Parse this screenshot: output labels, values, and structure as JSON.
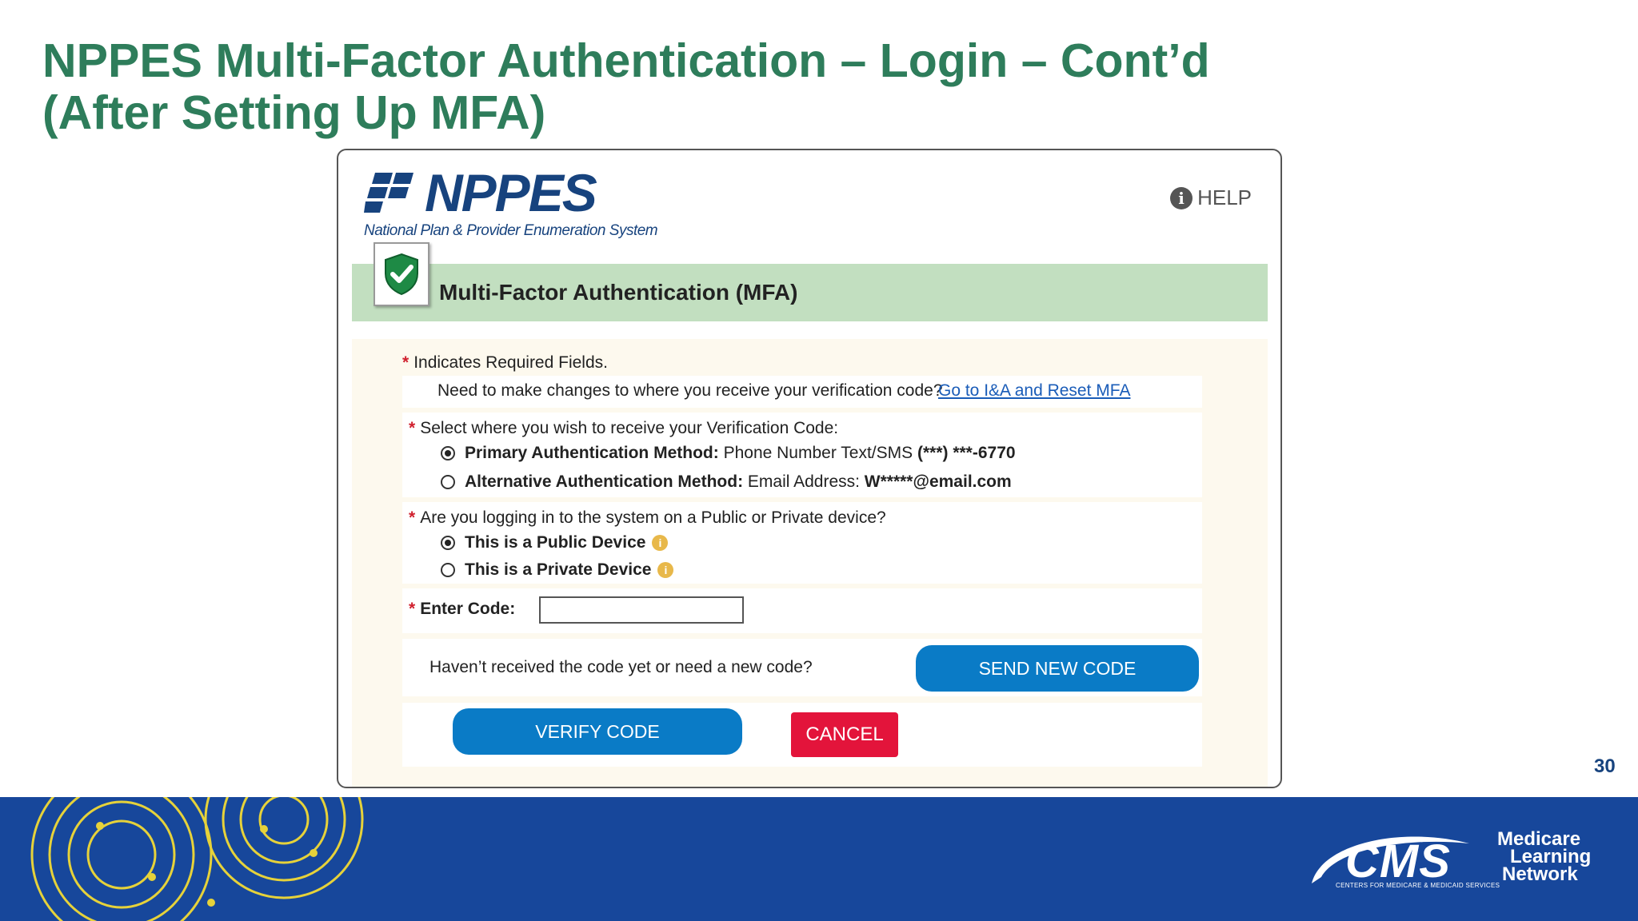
{
  "slide": {
    "title_line1": "NPPES Multi-Factor Authentication – Login – Cont’d",
    "title_line2": "(After Setting Up MFA)",
    "page_number": "30"
  },
  "header": {
    "logo_text": "NPPES",
    "logo_subtitle": "National Plan & Provider Enumeration System",
    "help_label": "HELP"
  },
  "mfa": {
    "title": "Multi-Factor Authentication (MFA)"
  },
  "form": {
    "required_marker": "*",
    "required_note": "Indicates Required Fields.",
    "changes_question": "Need to make changes to where you receive your verification code?",
    "changes_link": "Go to I&A and Reset MFA",
    "delivery_question": "Select where you wish to receive your Verification Code:",
    "delivery_options": [
      {
        "label": "Primary Authentication Method:",
        "detail": " Phone Number Text/SMS ",
        "value": "(***) ***-6770",
        "selected": true
      },
      {
        "label": "Alternative Authentication Method:",
        "detail": " Email Address: ",
        "value": "W*****@email.com",
        "selected": false
      }
    ],
    "device_question": "Are you logging in to the system on a Public or Private device?",
    "device_options": [
      {
        "label": "This is a Public Device",
        "selected": true
      },
      {
        "label": "This is a Private Device",
        "selected": false
      }
    ],
    "enter_code_label": "Enter Code:",
    "enter_code_value": "",
    "resend_question": "Haven’t received the code yet or need a new code?",
    "send_new_code_button": "SEND NEW CODE",
    "verify_button": "VERIFY CODE",
    "cancel_button": "CANCEL",
    "info_glyph": "i"
  },
  "footer": {
    "cms_logo_text": "CMS",
    "cms_subtitle": "CENTERS FOR MEDICARE & MEDICAID SERVICES",
    "mln_line1": "Medicare",
    "mln_line2": "Learning",
    "mln_line3": "Network"
  },
  "colors": {
    "title_green": "#2e7d5b",
    "nppes_blue": "#17437e",
    "mfa_bar_green": "#c2dfc0",
    "button_blue": "#0a7bc6",
    "cancel_red": "#e3143b",
    "footer_blue": "#17479b",
    "footer_accent_yellow": "#e6d23a"
  },
  "icons": {
    "help": "info-circle-icon",
    "shield": "shield-check-icon",
    "logo_mark": "nppes-logo-mark-icon",
    "info": "info-dot-icon"
  }
}
